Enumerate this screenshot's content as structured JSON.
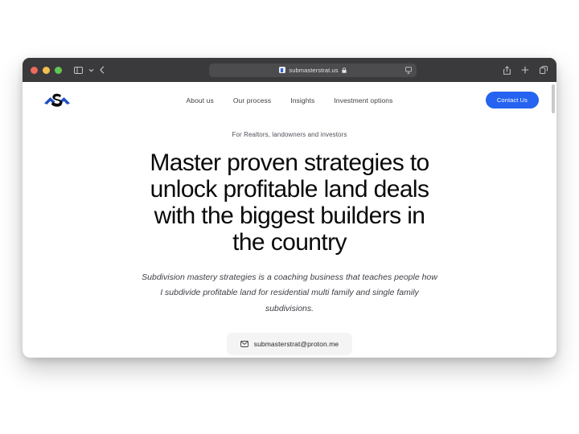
{
  "browser": {
    "window_controls": {
      "close_label": "close",
      "minimize_label": "minimize",
      "maximize_label": "maximize"
    },
    "sidebar_toggle_icon": "sidebar-icon",
    "sidebar_dropdown_icon": "chevron-down-icon",
    "back_icon": "chevron-left-icon",
    "address_bar": {
      "url": "submasterstrat.us",
      "favicon": "site-favicon",
      "lock_icon": "lock-icon",
      "reader_icon": "reader-view-icon"
    },
    "toolbar_right": {
      "share_icon": "share-icon",
      "new_tab_icon": "plus-icon",
      "tab_overview_icon": "tab-overview-icon"
    },
    "accent_color": "#2563f0",
    "chrome_color": "#3a3a3c"
  },
  "site": {
    "logo_name": "subdivision-mastery-logo",
    "nav": [
      {
        "label": "About us"
      },
      {
        "label": "Our process"
      },
      {
        "label": "Insights"
      },
      {
        "label": "Investment options"
      }
    ],
    "cta": {
      "label": "Contact Us",
      "color": "#2563f0"
    },
    "hero": {
      "eyebrow": "For Realtors, landowners and investors",
      "headline": "Master proven strategies to unlock profitable land deals with the biggest builders in the country",
      "subheadline": "Subdivision mastery strategies is a coaching business that teaches people how I subdivide profitable land for residential multi family and single family subdivisions.",
      "email": "submasterstrat@proton.me",
      "email_icon": "envelope-icon"
    }
  }
}
